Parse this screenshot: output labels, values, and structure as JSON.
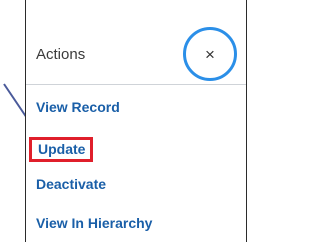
{
  "panel": {
    "title": "Actions",
    "close_glyph": "×"
  },
  "menu": {
    "items": [
      {
        "label": "View Record"
      },
      {
        "label": "Update"
      },
      {
        "label": "Deactivate"
      },
      {
        "label": "View In Hierarchy"
      }
    ]
  },
  "annotations": {
    "highlight_color": "#e01f2b",
    "circle_color": "#2b8fe8",
    "arrow_color": "#4a5a9a"
  },
  "icons": {
    "close": "close-icon",
    "pointer": "pointer-arrow-icon"
  }
}
